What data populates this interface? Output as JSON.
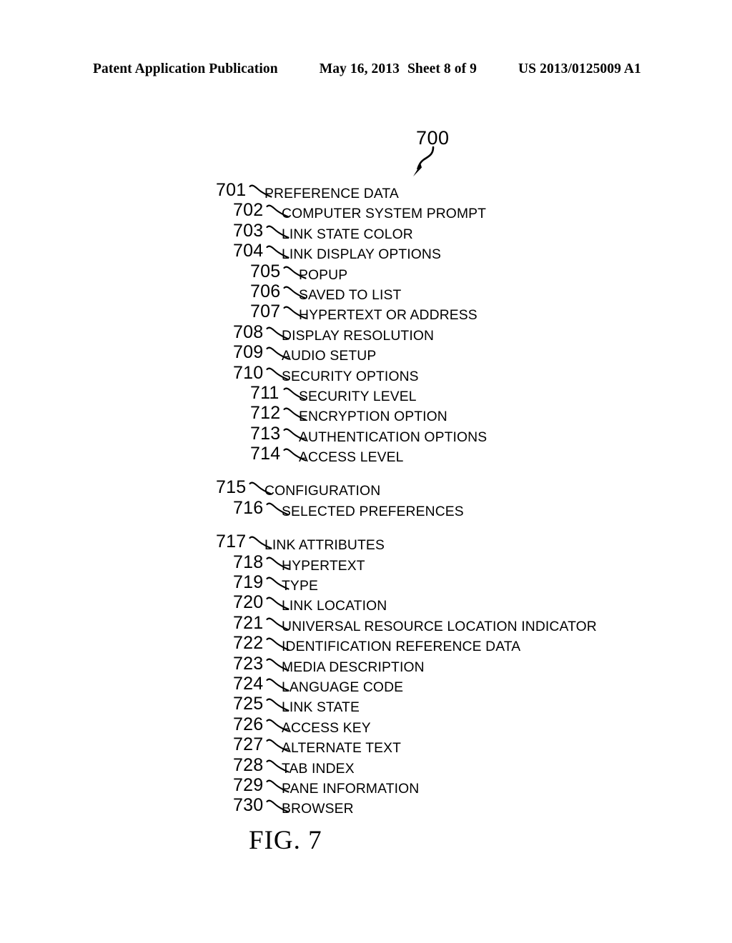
{
  "header": {
    "publication": "Patent Application Publication",
    "date": "May 16, 2013",
    "sheet": "Sheet 8 of 9",
    "doc_number": "US 2013/0125009 A1"
  },
  "figure": {
    "ref_number": "700",
    "caption": "FIG. 7",
    "lead_arrow_icon": "curved-arrow-icon"
  },
  "tree": {
    "items": [
      {
        "ref": "701",
        "label": "PREFERENCE DATA",
        "level": 0,
        "gap_before": false
      },
      {
        "ref": "702",
        "label": "COMPUTER SYSTEM PROMPT",
        "level": 1,
        "gap_before": false
      },
      {
        "ref": "703",
        "label": "LINK STATE COLOR",
        "level": 1,
        "gap_before": false
      },
      {
        "ref": "704",
        "label": "LINK DISPLAY OPTIONS",
        "level": 1,
        "gap_before": false
      },
      {
        "ref": "705",
        "label": "POPUP",
        "level": 2,
        "gap_before": false
      },
      {
        "ref": "706",
        "label": "SAVED TO LIST",
        "level": 2,
        "gap_before": false
      },
      {
        "ref": "707",
        "label": "HYPERTEXT OR ADDRESS",
        "level": 2,
        "gap_before": false
      },
      {
        "ref": "708",
        "label": "DISPLAY RESOLUTION",
        "level": 1,
        "gap_before": false
      },
      {
        "ref": "709",
        "label": "AUDIO SETUP",
        "level": 1,
        "gap_before": false
      },
      {
        "ref": "710",
        "label": "SECURITY OPTIONS",
        "level": 1,
        "gap_before": false
      },
      {
        "ref": "711",
        "label": "SECURITY LEVEL",
        "level": 2,
        "gap_before": false
      },
      {
        "ref": "712",
        "label": "ENCRYPTION OPTION",
        "level": 2,
        "gap_before": false
      },
      {
        "ref": "713",
        "label": "AUTHENTICATION OPTIONS",
        "level": 2,
        "gap_before": false
      },
      {
        "ref": "714",
        "label": "ACCESS LEVEL",
        "level": 2,
        "gap_before": false
      },
      {
        "ref": "715",
        "label": "CONFIGURATION",
        "level": 0,
        "gap_before": true
      },
      {
        "ref": "716",
        "label": "SELECTED PREFERENCES",
        "level": 1,
        "gap_before": false
      },
      {
        "ref": "717",
        "label": "LINK ATTRIBUTES",
        "level": 0,
        "gap_before": true
      },
      {
        "ref": "718",
        "label": "HYPERTEXT",
        "level": 1,
        "gap_before": false
      },
      {
        "ref": "719",
        "label": "TYPE",
        "level": 1,
        "gap_before": false
      },
      {
        "ref": "720",
        "label": "LINK LOCATION",
        "level": 1,
        "gap_before": false
      },
      {
        "ref": "721",
        "label": "UNIVERSAL RESOURCE LOCATION INDICATOR",
        "level": 1,
        "gap_before": false
      },
      {
        "ref": "722",
        "label": "IDENTIFICATION REFERENCE DATA",
        "level": 1,
        "gap_before": false
      },
      {
        "ref": "723",
        "label": "MEDIA DESCRIPTION",
        "level": 1,
        "gap_before": false
      },
      {
        "ref": "724",
        "label": "LANGUAGE CODE",
        "level": 1,
        "gap_before": false
      },
      {
        "ref": "725",
        "label": "LINK STATE",
        "level": 1,
        "gap_before": false
      },
      {
        "ref": "726",
        "label": "ACCESS KEY",
        "level": 1,
        "gap_before": false
      },
      {
        "ref": "727",
        "label": "ALTERNATE TEXT",
        "level": 1,
        "gap_before": false
      },
      {
        "ref": "728",
        "label": "TAB INDEX",
        "level": 1,
        "gap_before": false
      },
      {
        "ref": "729",
        "label": "PANE INFORMATION",
        "level": 1,
        "gap_before": false
      },
      {
        "ref": "730",
        "label": "BROWSER",
        "level": 1,
        "gap_before": false
      }
    ],
    "connector_icon": "squiggle-leader-line-icon"
  },
  "colors": {
    "ink": "#000000",
    "paper": "#ffffff"
  }
}
